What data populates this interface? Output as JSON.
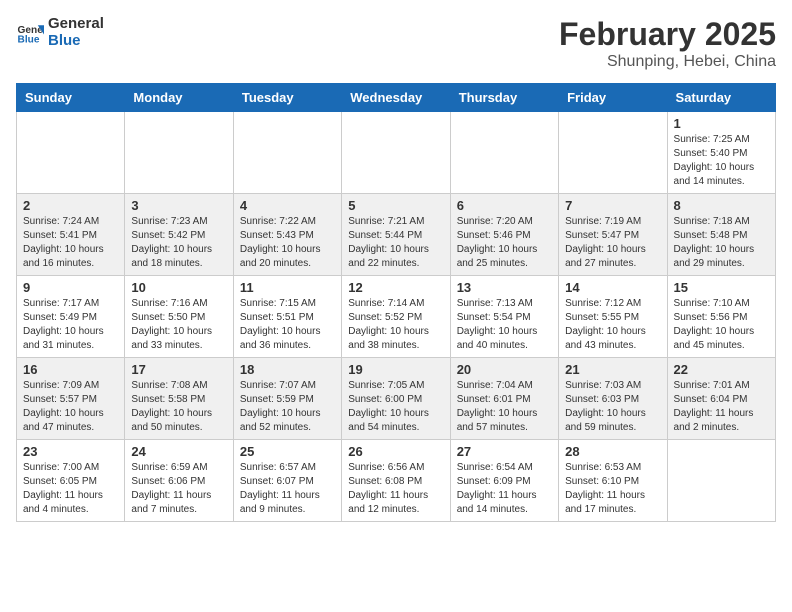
{
  "header": {
    "logo_general": "General",
    "logo_blue": "Blue",
    "month_year": "February 2025",
    "location": "Shunping, Hebei, China"
  },
  "weekdays": [
    "Sunday",
    "Monday",
    "Tuesday",
    "Wednesday",
    "Thursday",
    "Friday",
    "Saturday"
  ],
  "weeks": [
    [
      {
        "day": "",
        "info": ""
      },
      {
        "day": "",
        "info": ""
      },
      {
        "day": "",
        "info": ""
      },
      {
        "day": "",
        "info": ""
      },
      {
        "day": "",
        "info": ""
      },
      {
        "day": "",
        "info": ""
      },
      {
        "day": "1",
        "info": "Sunrise: 7:25 AM\nSunset: 5:40 PM\nDaylight: 10 hours and 14 minutes."
      }
    ],
    [
      {
        "day": "2",
        "info": "Sunrise: 7:24 AM\nSunset: 5:41 PM\nDaylight: 10 hours and 16 minutes."
      },
      {
        "day": "3",
        "info": "Sunrise: 7:23 AM\nSunset: 5:42 PM\nDaylight: 10 hours and 18 minutes."
      },
      {
        "day": "4",
        "info": "Sunrise: 7:22 AM\nSunset: 5:43 PM\nDaylight: 10 hours and 20 minutes."
      },
      {
        "day": "5",
        "info": "Sunrise: 7:21 AM\nSunset: 5:44 PM\nDaylight: 10 hours and 22 minutes."
      },
      {
        "day": "6",
        "info": "Sunrise: 7:20 AM\nSunset: 5:46 PM\nDaylight: 10 hours and 25 minutes."
      },
      {
        "day": "7",
        "info": "Sunrise: 7:19 AM\nSunset: 5:47 PM\nDaylight: 10 hours and 27 minutes."
      },
      {
        "day": "8",
        "info": "Sunrise: 7:18 AM\nSunset: 5:48 PM\nDaylight: 10 hours and 29 minutes."
      }
    ],
    [
      {
        "day": "9",
        "info": "Sunrise: 7:17 AM\nSunset: 5:49 PM\nDaylight: 10 hours and 31 minutes."
      },
      {
        "day": "10",
        "info": "Sunrise: 7:16 AM\nSunset: 5:50 PM\nDaylight: 10 hours and 33 minutes."
      },
      {
        "day": "11",
        "info": "Sunrise: 7:15 AM\nSunset: 5:51 PM\nDaylight: 10 hours and 36 minutes."
      },
      {
        "day": "12",
        "info": "Sunrise: 7:14 AM\nSunset: 5:52 PM\nDaylight: 10 hours and 38 minutes."
      },
      {
        "day": "13",
        "info": "Sunrise: 7:13 AM\nSunset: 5:54 PM\nDaylight: 10 hours and 40 minutes."
      },
      {
        "day": "14",
        "info": "Sunrise: 7:12 AM\nSunset: 5:55 PM\nDaylight: 10 hours and 43 minutes."
      },
      {
        "day": "15",
        "info": "Sunrise: 7:10 AM\nSunset: 5:56 PM\nDaylight: 10 hours and 45 minutes."
      }
    ],
    [
      {
        "day": "16",
        "info": "Sunrise: 7:09 AM\nSunset: 5:57 PM\nDaylight: 10 hours and 47 minutes."
      },
      {
        "day": "17",
        "info": "Sunrise: 7:08 AM\nSunset: 5:58 PM\nDaylight: 10 hours and 50 minutes."
      },
      {
        "day": "18",
        "info": "Sunrise: 7:07 AM\nSunset: 5:59 PM\nDaylight: 10 hours and 52 minutes."
      },
      {
        "day": "19",
        "info": "Sunrise: 7:05 AM\nSunset: 6:00 PM\nDaylight: 10 hours and 54 minutes."
      },
      {
        "day": "20",
        "info": "Sunrise: 7:04 AM\nSunset: 6:01 PM\nDaylight: 10 hours and 57 minutes."
      },
      {
        "day": "21",
        "info": "Sunrise: 7:03 AM\nSunset: 6:03 PM\nDaylight: 10 hours and 59 minutes."
      },
      {
        "day": "22",
        "info": "Sunrise: 7:01 AM\nSunset: 6:04 PM\nDaylight: 11 hours and 2 minutes."
      }
    ],
    [
      {
        "day": "23",
        "info": "Sunrise: 7:00 AM\nSunset: 6:05 PM\nDaylight: 11 hours and 4 minutes."
      },
      {
        "day": "24",
        "info": "Sunrise: 6:59 AM\nSunset: 6:06 PM\nDaylight: 11 hours and 7 minutes."
      },
      {
        "day": "25",
        "info": "Sunrise: 6:57 AM\nSunset: 6:07 PM\nDaylight: 11 hours and 9 minutes."
      },
      {
        "day": "26",
        "info": "Sunrise: 6:56 AM\nSunset: 6:08 PM\nDaylight: 11 hours and 12 minutes."
      },
      {
        "day": "27",
        "info": "Sunrise: 6:54 AM\nSunset: 6:09 PM\nDaylight: 11 hours and 14 minutes."
      },
      {
        "day": "28",
        "info": "Sunrise: 6:53 AM\nSunset: 6:10 PM\nDaylight: 11 hours and 17 minutes."
      },
      {
        "day": "",
        "info": ""
      }
    ]
  ]
}
